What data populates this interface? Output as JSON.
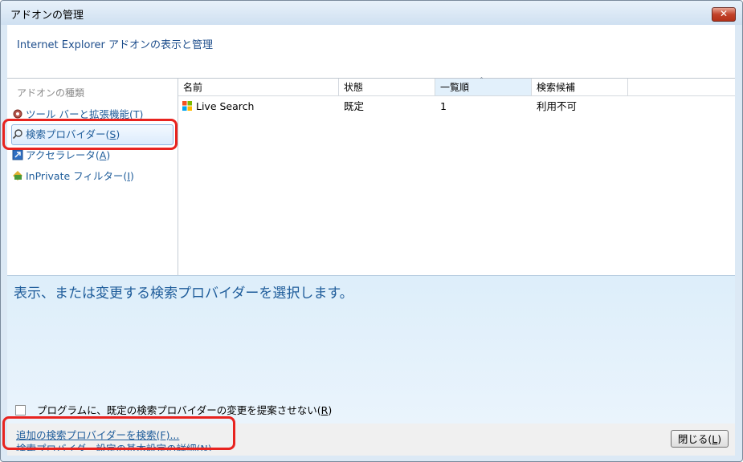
{
  "window": {
    "title": "アドオンの管理",
    "close_glyph": "✕"
  },
  "header": {
    "text": "Internet Explorer アドオンの表示と管理"
  },
  "sidebar": {
    "title": "アドオンの種類",
    "items": [
      {
        "label": "ツール バーと拡張機能",
        "key": "T",
        "icon": "gear-icon"
      },
      {
        "label": "検索プロバイダー",
        "key": "S",
        "icon": "search-icon"
      },
      {
        "label": "アクセラレータ",
        "key": "A",
        "icon": "accelerator-icon"
      },
      {
        "label": "InPrivate フィルター",
        "key": "I",
        "icon": "inprivate-icon"
      }
    ]
  },
  "table": {
    "columns": [
      "名前",
      "状態",
      "一覧順",
      "検索候補"
    ],
    "sort_arrow": "ˆ",
    "rows": [
      {
        "name": "Live Search",
        "status": "既定",
        "order": "1",
        "suggest": "利用不可",
        "icon": "windows-logo-icon"
      }
    ]
  },
  "detail": {
    "description": "表示、または変更する検索プロバイダーを選択します。",
    "checkbox_label": "プログラムに、既定の検索プロバイダーの変更を提案させない",
    "checkbox_key": "R"
  },
  "footer": {
    "link_find": "追加の検索プロバイダーを検索(F)...",
    "link_learn": "検索プロバイダー設定の基本設定の詳細(N)",
    "close_label": "閉じる",
    "close_key": "L"
  },
  "colors": {
    "highlight": "#e8231f",
    "link": "#1e5c9a"
  }
}
